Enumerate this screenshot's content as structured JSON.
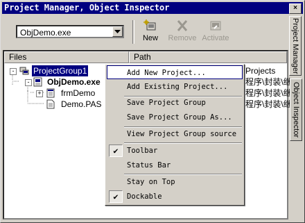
{
  "window": {
    "title": "Project Manager, Object Inspector",
    "close_glyph": "×"
  },
  "toolbar": {
    "project_combo_value": "ObjDemo.exe",
    "buttons": [
      {
        "label": "New",
        "icon": "new-icon",
        "enabled": true
      },
      {
        "label": "Remove",
        "icon": "remove-icon",
        "enabled": false
      },
      {
        "label": "Activate",
        "icon": "activate-icon",
        "enabled": false
      }
    ]
  },
  "columns": {
    "files": "Files",
    "path": "Path"
  },
  "tree": [
    {
      "label": "ProjectGroup1",
      "expander": "-",
      "selected": true,
      "icon": "project-group-icon",
      "path": "Projects"
    },
    {
      "label": "ObjDemo.exe",
      "expander": "-",
      "bold": true,
      "icon": "project-icon",
      "path": "程序\\封装\\继"
    },
    {
      "label": "frmDemo",
      "expander": "+",
      "icon": "form-icon",
      "path": "程序\\封装\\继"
    },
    {
      "label": "Demo.PAS",
      "expander": "",
      "icon": "unit-icon",
      "path": "程序\\封装\\继"
    }
  ],
  "side_tabs": [
    "Project Manager",
    "Object Inspector"
  ],
  "context_menu": {
    "items": [
      {
        "label": "Add New Project...",
        "highlighted": true,
        "checked": false
      },
      {
        "label": "Add Existing Project...",
        "checked": false
      },
      {
        "label": "Save Project Group",
        "checked": false
      },
      {
        "label": "Save Project Group As...",
        "checked": false
      },
      {
        "label": "View Project Group source",
        "checked": false
      },
      {
        "label": "Toolbar",
        "checked": true
      },
      {
        "label": "Status Bar",
        "checked": false
      },
      {
        "label": "Stay on Top",
        "checked": false
      },
      {
        "label": "Dockable",
        "checked": true
      }
    ],
    "check_glyph": "✔"
  },
  "colors": {
    "title_bar": "#000080",
    "selection": "#000080",
    "face": "#d4d0c8"
  }
}
